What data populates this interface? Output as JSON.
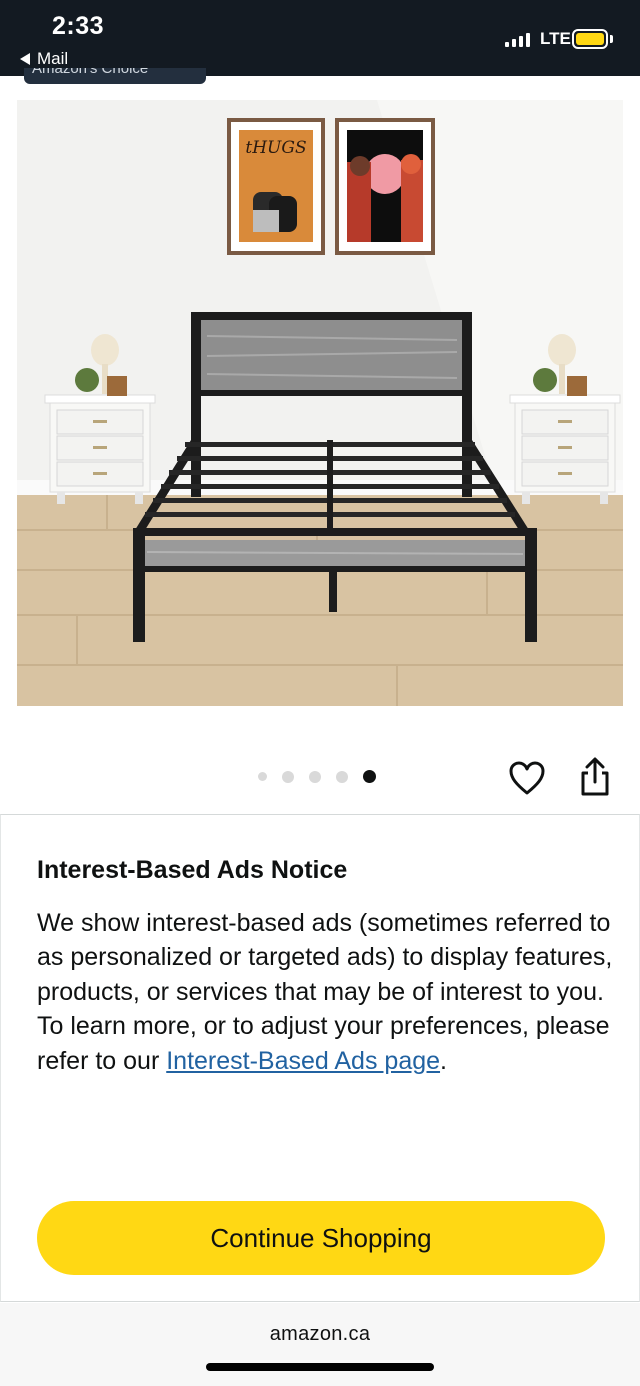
{
  "status_bar": {
    "time": "2:33",
    "back_label": "Mail",
    "network": "LTE",
    "battery_color": "#ffd814"
  },
  "product": {
    "badge_label": "Amazon's Choice",
    "image_alt": "Metal bed frame with grey wood headboard",
    "poster_text": "tHUGS",
    "carousel": {
      "total": 5,
      "active_index": 5
    }
  },
  "actions": {
    "favorite_icon": "heart-icon",
    "share_icon": "share-icon"
  },
  "notice": {
    "title": "Interest-Based Ads Notice",
    "body": "We show interest-based ads (sometimes referred to as personalized or targeted ads) to display features, products, or services that may be of interest to you. To learn more, or to adjust your preferences, please refer to our ",
    "link_text": "Interest-Based Ads page",
    "trailing": ".",
    "button_label": "Continue Shopping",
    "button_color": "#ffd814",
    "link_color": "#2162a1"
  },
  "browser": {
    "url": "amazon.ca"
  }
}
